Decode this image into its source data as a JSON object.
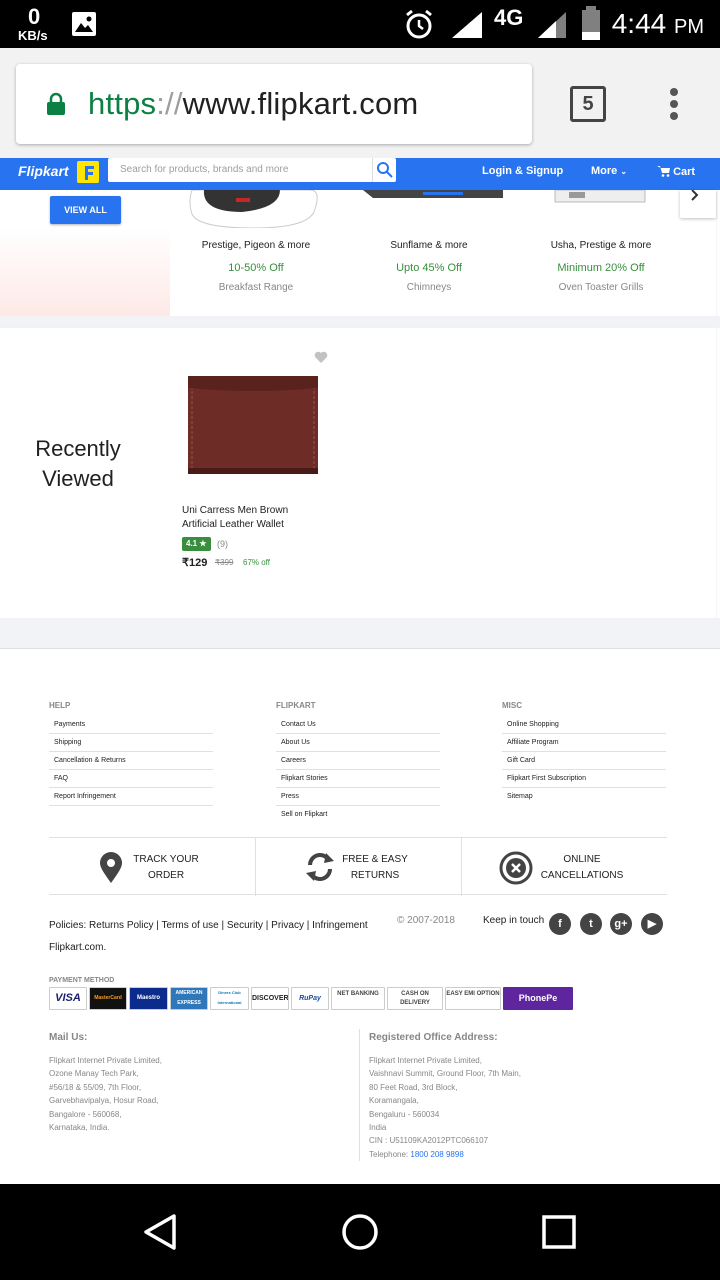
{
  "status_bar": {
    "kb_value": "0",
    "kb_unit": "KB/s",
    "network": "4G",
    "time": "4:44",
    "ampm": "PM"
  },
  "browser": {
    "url_scheme": "https",
    "url_sep": "://",
    "url_host": "www.flipkart.com",
    "tab_count": "5"
  },
  "header": {
    "logo": "Flipkart",
    "search_placeholder": "Search for products, brands and more",
    "login": "Login & Signup",
    "more": "More",
    "cart": "Cart"
  },
  "deals": {
    "view_all": "VIEW ALL",
    "items": [
      {
        "name": "Prestige, Pigeon & more",
        "offer": "10-50% Off",
        "category": "Breakfast Range"
      },
      {
        "name": "Sunflame & more",
        "offer": "Upto 45% Off",
        "category": "Chimneys"
      },
      {
        "name": "Usha, Prestige & more",
        "offer": "Minimum 20% Off",
        "category": "Oven Toaster Grills"
      }
    ]
  },
  "recently_viewed": {
    "title_line1": "Recently",
    "title_line2": "Viewed",
    "product": {
      "name": "Uni Carress Men Brown Artificial Leather Wallet",
      "rating": "4.1 ★",
      "rating_count": "(9)",
      "price": "₹129",
      "mrp": "₹399",
      "discount": "67% off"
    }
  },
  "footer": {
    "columns": [
      {
        "heading": "HELP",
        "items": [
          "Payments",
          "Shipping",
          "Cancellation & Returns",
          "FAQ",
          "Report Infringement"
        ]
      },
      {
        "heading": "FLIPKART",
        "items": [
          "Contact Us",
          "About Us",
          "Careers",
          "Flipkart Stories",
          "Press",
          "Sell on Flipkart"
        ]
      },
      {
        "heading": "MISC",
        "items": [
          "Online Shopping",
          "Affiliate Program",
          "Gift Card",
          "Flipkart First Subscription",
          "Sitemap"
        ]
      }
    ],
    "services": [
      {
        "line1": "TRACK YOUR",
        "line2": "ORDER"
      },
      {
        "line1": "FREE & EASY",
        "line2": "RETURNS"
      },
      {
        "line1": "ONLINE",
        "line2": "CANCELLATIONS"
      }
    ],
    "policies_label": "Policies:",
    "policies": [
      "Returns Policy",
      "Terms of use",
      "Security",
      "Privacy",
      "Infringement"
    ],
    "domain": "Flipkart.com.",
    "copyright": "© 2007-2018",
    "keep_in_touch": "Keep in touch",
    "payment_heading": "PAYMENT METHOD",
    "payments": [
      "VISA",
      "MasterCard",
      "Maestro",
      "AMERICAN EXPRESS",
      "Diners Club International",
      "DISCOVER",
      "RuPay",
      "NET BANKING",
      "CASH ON DELIVERY",
      "EASY EMI OPTION",
      "PhonePe"
    ],
    "mail_heading": "Mail Us:",
    "mail_lines": [
      "Flipkart Internet Private Limited,",
      "Ozone Manay Tech Park,",
      "#56/18 & 55/09, 7th Floor,",
      "Garvebhavipalya, Hosur Road,",
      "Bangalore - 560068,",
      "Karnataka, India."
    ],
    "reg_heading": "Registered Office Address:",
    "reg_lines": [
      "Flipkart Internet Private Limited,",
      "Vaishnavi Summit, Ground Floor, 7th Main,",
      "80 Feet Road, 3rd Block,",
      "Koramangala,",
      "Bengaluru - 560034",
      "India",
      "CIN : U51109KA2012PTC066107"
    ],
    "reg_phone_label": "Telephone:",
    "reg_phone": "1800 208 9898"
  },
  "colors": {
    "brand_blue": "#2874f0",
    "brand_yellow": "#ffe500",
    "offer_green": "#388e3c"
  }
}
